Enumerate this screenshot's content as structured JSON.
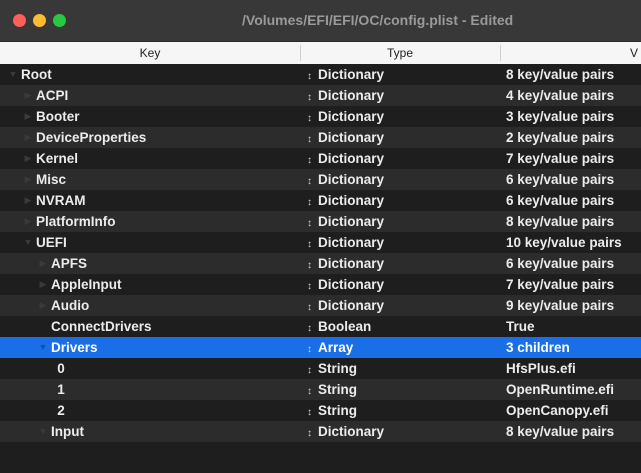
{
  "window": {
    "title": "/Volumes/EFI/EFI/OC/config.plist - Edited"
  },
  "columns": {
    "key": "Key",
    "type": "Type",
    "value": "V"
  },
  "icons": {
    "disclosure_open": "chevron-down-icon",
    "disclosure_closed": "chevron-right-icon",
    "type_popup": "updown-arrows-icon"
  },
  "colors": {
    "selection": "#1a6fe8",
    "close": "#fe5f57",
    "minimize": "#febc2e",
    "maximize": "#28c840"
  },
  "rows": [
    {
      "key": "Root",
      "type": "Dictionary",
      "value": "8 key/value pairs",
      "depth": 0,
      "expanded": true
    },
    {
      "key": "ACPI",
      "type": "Dictionary",
      "value": "4 key/value pairs",
      "depth": 1,
      "expanded": false
    },
    {
      "key": "Booter",
      "type": "Dictionary",
      "value": "3 key/value pairs",
      "depth": 1,
      "expanded": false
    },
    {
      "key": "DeviceProperties",
      "type": "Dictionary",
      "value": "2 key/value pairs",
      "depth": 1,
      "expanded": false
    },
    {
      "key": "Kernel",
      "type": "Dictionary",
      "value": "7 key/value pairs",
      "depth": 1,
      "expanded": false
    },
    {
      "key": "Misc",
      "type": "Dictionary",
      "value": "6 key/value pairs",
      "depth": 1,
      "expanded": false
    },
    {
      "key": "NVRAM",
      "type": "Dictionary",
      "value": "6 key/value pairs",
      "depth": 1,
      "expanded": false
    },
    {
      "key": "PlatformInfo",
      "type": "Dictionary",
      "value": "8 key/value pairs",
      "depth": 1,
      "expanded": false
    },
    {
      "key": "UEFI",
      "type": "Dictionary",
      "value": "10 key/value pairs",
      "depth": 1,
      "expanded": true
    },
    {
      "key": "APFS",
      "type": "Dictionary",
      "value": "6 key/value pairs",
      "depth": 2,
      "expanded": false
    },
    {
      "key": "AppleInput",
      "type": "Dictionary",
      "value": "7 key/value pairs",
      "depth": 2,
      "expanded": false
    },
    {
      "key": "Audio",
      "type": "Dictionary",
      "value": "9 key/value pairs",
      "depth": 2,
      "expanded": false
    },
    {
      "key": "ConnectDrivers",
      "type": "Boolean",
      "value": "True",
      "depth": 2,
      "leaf": true
    },
    {
      "key": "Drivers",
      "type": "Array",
      "value": "3 children",
      "depth": 2,
      "expanded": true,
      "selected": true
    },
    {
      "key": "0",
      "type": "String",
      "value": "HfsPlus.efi",
      "depth": 3,
      "leaf": true,
      "center": true
    },
    {
      "key": "1",
      "type": "String",
      "value": "OpenRuntime.efi",
      "depth": 3,
      "leaf": true,
      "center": true
    },
    {
      "key": "2",
      "type": "String",
      "value": "OpenCanopy.efi",
      "depth": 3,
      "leaf": true,
      "center": true
    },
    {
      "key": "Input",
      "type": "Dictionary",
      "value": "8 key/value pairs",
      "depth": 2,
      "expanded": true
    }
  ]
}
